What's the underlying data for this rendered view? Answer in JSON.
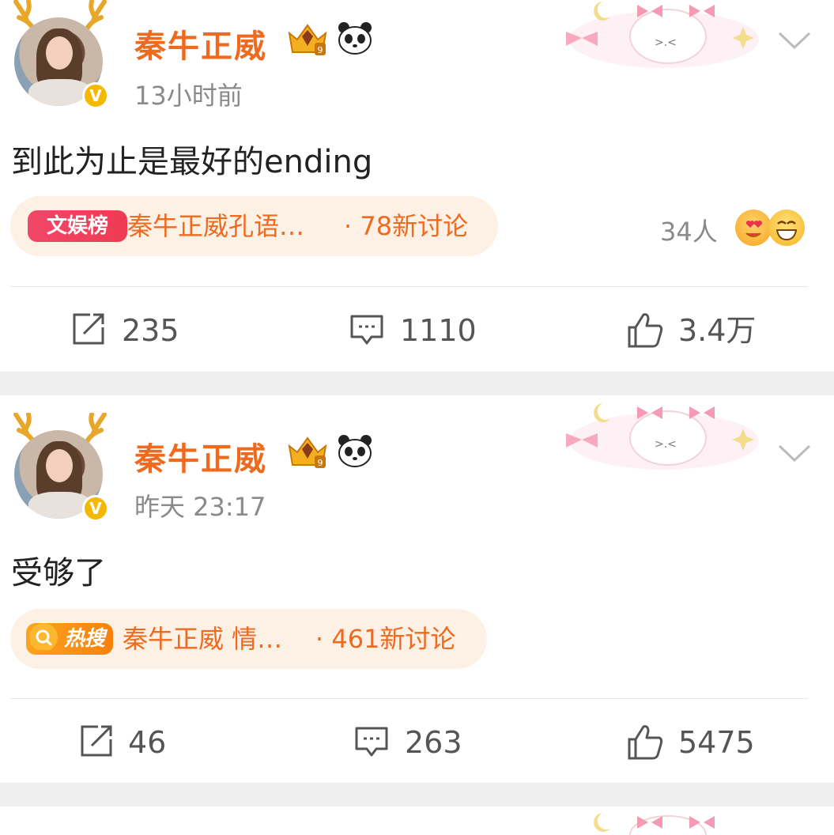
{
  "posts": [
    {
      "author": "秦牛正威",
      "time": "13小时前",
      "text": "到此为止是最好的ending",
      "tag": {
        "badge": "文娱榜",
        "label": "秦牛正威孔语…",
        "count": "· 78新讨论"
      },
      "reactions": "34人",
      "stats": {
        "reposts": "235",
        "comments": "1110",
        "likes": "3.4万"
      }
    },
    {
      "author": "秦牛正威",
      "time": "昨天 23:17",
      "text": "受够了",
      "tag": {
        "badge": "热搜",
        "label": "秦牛正威 情…",
        "count": "· 461新讨论"
      },
      "stats": {
        "reposts": "46",
        "comments": "263",
        "likes": "5475"
      }
    }
  ],
  "icons": [
    "antler-icon",
    "verified-badge-icon",
    "vip-crown-icon",
    "panda-icon",
    "decoration-sticker",
    "chevron-down-icon",
    "repost-icon",
    "comment-icon",
    "like-icon",
    "search-icon"
  ],
  "colors": {
    "name": "#ee6a1f",
    "time": "#8a8a8a",
    "tagBg": "#fdf0e4",
    "badgeRank": "#ef3d5b",
    "badgeHot": "#f98c10"
  }
}
